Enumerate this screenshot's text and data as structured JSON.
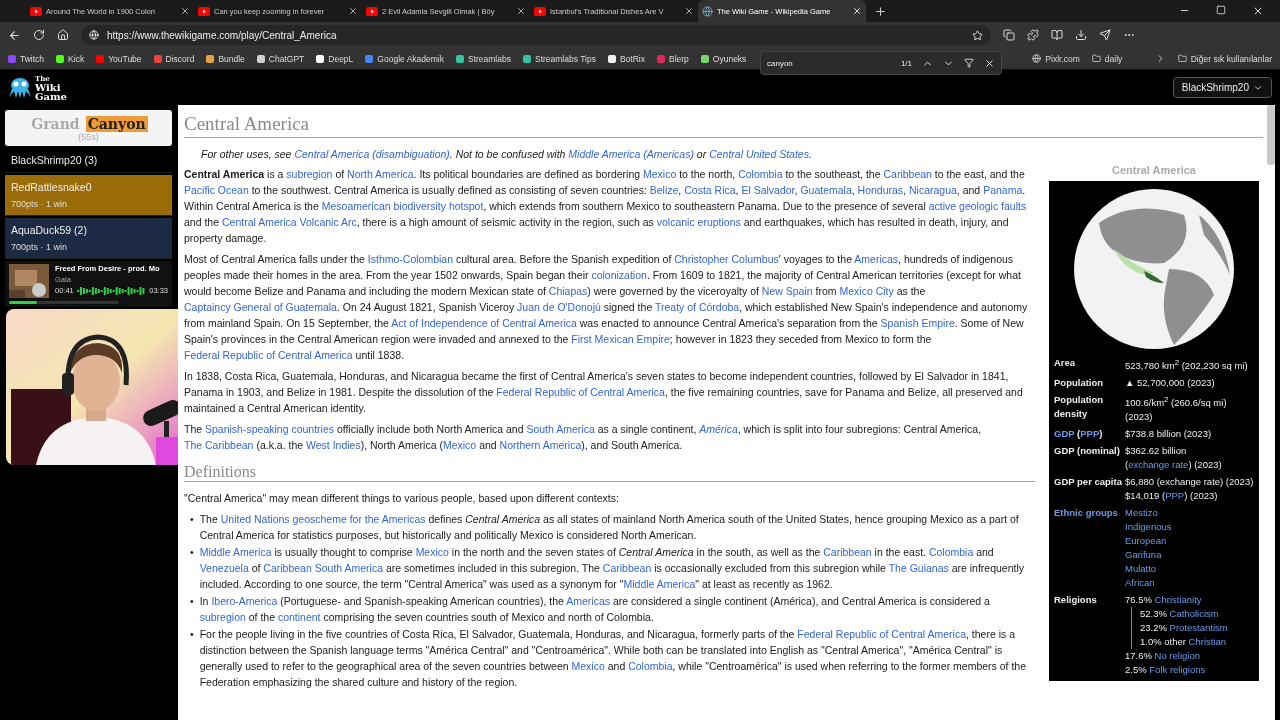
{
  "browser": {
    "tabs": [
      {
        "title": "Around The World in 1900 Colori",
        "kind": "video",
        "selected": false
      },
      {
        "title": "Can you keep zooming in forever",
        "kind": "video",
        "selected": false
      },
      {
        "title": "2 Evli Adamla Sevgili Olmak | Böy",
        "kind": "video",
        "selected": false
      },
      {
        "title": "Istanbul's Traditional Dishes Are V",
        "kind": "video",
        "selected": false
      },
      {
        "title": "The Wiki Game - Wikipedia Game",
        "kind": "page",
        "selected": true
      }
    ],
    "url": "https://www.thewikigame.com/play/Central_America",
    "bookmarks": [
      {
        "label": "Twitch",
        "color": "#9146ff"
      },
      {
        "label": "Kick",
        "color": "#53fc18"
      },
      {
        "label": "YouTube",
        "color": "#ff0000"
      },
      {
        "label": "Discord",
        "color": "#e8453c"
      },
      {
        "label": "Bundle",
        "color": "#e6a23c"
      },
      {
        "label": "ChatGPT",
        "color": "#d0d0d0"
      },
      {
        "label": "DeepL",
        "color": "#ffffff"
      },
      {
        "label": "Google Akademik",
        "color": "#4285f4"
      },
      {
        "label": "Streamlabs",
        "color": "#31c3a2"
      },
      {
        "label": "Streamlabs Tips",
        "color": "#31c3a2"
      },
      {
        "label": "BotRix",
        "color": "#f0f0f0"
      },
      {
        "label": "Blerp",
        "color": "#e0245e"
      },
      {
        "label": "Oyuneks",
        "color": "#7ad66a"
      }
    ],
    "bookmarks_right": [
      {
        "label": "Pixlr.com",
        "kind": "site"
      },
      {
        "label": "daily",
        "kind": "folder"
      }
    ],
    "other_bookmarks": "Diğer sık kullanılanlar",
    "find_bar": {
      "value": "canyon",
      "count": "1/1"
    }
  },
  "header": {
    "logo": [
      "The",
      "Wiki",
      "Game"
    ],
    "user": "BlackShrimp20"
  },
  "target": {
    "parts": [
      {
        "text": "Grand",
        "match": false
      },
      {
        "text": "Canyon",
        "match": true
      }
    ],
    "time": "(55s)"
  },
  "players": [
    {
      "name": "BlackShrimp20 (3)",
      "color": "#000000"
    },
    {
      "name": "RedRattlesnake0",
      "stats": "700pts · 1 win",
      "color": "#9a6d0a"
    },
    {
      "name": "AquaDuck59 (2)",
      "stats": "700pts · 1 win",
      "color": "#1c2a44"
    }
  ],
  "music": {
    "title": "Freed From Desire - prod. Mo",
    "artist": "Gala",
    "elapsed": "00:41",
    "total": "03:33",
    "level": 0.25
  },
  "article": {
    "title": "Central America",
    "hatnote": [
      {
        "text": "For other uses, see "
      },
      {
        "link": "Central America (disambiguation)"
      },
      {
        "text": ". Not to be confused with "
      },
      {
        "link": "Middle America (Americas)"
      },
      {
        "text": " or "
      },
      {
        "link": "Central United States"
      },
      {
        "text": "."
      }
    ],
    "paragraphs": [
      [
        {
          "text": "**Central America** is a "
        },
        {
          "link": "subregion"
        },
        {
          "text": " of "
        },
        {
          "link": "North America"
        },
        {
          "text": ". Its political boundaries are defined as bordering "
        },
        {
          "link": "Mexico"
        },
        {
          "text": " to the north, "
        },
        {
          "link": "Colombia"
        },
        {
          "text": " to the southeast, the "
        },
        {
          "link": "Caribbean"
        },
        {
          "text": " to the east, and the "
        },
        {
          "link": "Pacific Ocean"
        },
        {
          "text": " to the southwest. Central America is usually defined as consisting of seven countries: "
        },
        {
          "link": "Belize"
        },
        {
          "text": ", "
        },
        {
          "link": "Costa Rica"
        },
        {
          "text": ", "
        },
        {
          "link": "El Salvador"
        },
        {
          "text": ", "
        },
        {
          "link": "Guatemala"
        },
        {
          "text": ", "
        },
        {
          "link": "Honduras"
        },
        {
          "text": ", "
        },
        {
          "link": "Nicaragua"
        },
        {
          "text": ", and "
        },
        {
          "link": "Panama"
        },
        {
          "text": ". Within Central America is the "
        },
        {
          "link": "Mesoamerican biodiversity hotspot"
        },
        {
          "text": ", which extends from southern Mexico to southeastern Panama. Due to the presence of several "
        },
        {
          "link": "active geologic faults"
        },
        {
          "text": " and the "
        },
        {
          "link": "Central America Volcanic Arc"
        },
        {
          "text": ", there is a high amount of seismic activity in the region, such as "
        },
        {
          "link": "volcanic eruptions"
        },
        {
          "text": " and earthquakes, which has resulted in death, injury, and property damage."
        }
      ],
      [
        {
          "text": "Most of Central America falls under the "
        },
        {
          "link": "Isthmo-Colombian"
        },
        {
          "text": " cultural area. Before the Spanish expedition of "
        },
        {
          "link": "Christopher Columbus"
        },
        {
          "text": "' voyages to the "
        },
        {
          "link": "Americas"
        },
        {
          "text": ", hundreds of indigenous peoples made their homes in the area. From the year 1502 onwards, Spain began their "
        },
        {
          "link": "colonization"
        },
        {
          "text": ". From 1609 to 1821, the majority of Central American territories (except for what would become Belize and Panama and including the modern Mexican state of "
        },
        {
          "link": "Chiapas"
        },
        {
          "text": ") were governed by the viceroyalty of "
        },
        {
          "link": "New Spain"
        },
        {
          "text": " from "
        },
        {
          "link": "Mexico City"
        },
        {
          "text": " as the "
        },
        {
          "link": "Captaincy General of Guatemala"
        },
        {
          "text": ". On 24 August 1821, Spanish Viceroy "
        },
        {
          "link": "Juan de O'Donojú"
        },
        {
          "text": " signed the "
        },
        {
          "link": "Treaty of Córdoba"
        },
        {
          "text": ", which established New Spain's independence and autonomy from mainland Spain. On 15 September, the "
        },
        {
          "link": "Act of Independence of Central America"
        },
        {
          "text": " was enacted to announce Central America's separation from the "
        },
        {
          "link": "Spanish Empire"
        },
        {
          "text": ". Some of New Spain's provinces in the Central American region were invaded and annexed to the "
        },
        {
          "link": "First Mexican Empire"
        },
        {
          "text": "; however in 1823 they seceded from Mexico to form the "
        },
        {
          "link": "Federal Republic of Central America"
        },
        {
          "text": " until 1838."
        }
      ],
      [
        {
          "text": "In 1838, Costa Rica, Guatemala, Honduras, and Nicaragua became the first of Central America's seven states to become independent countries, followed by El Salvador in 1841, Panama in 1903, and Belize in 1981. Despite the dissolution of the "
        },
        {
          "link": "Federal Republic of Central America"
        },
        {
          "text": ", the five remaining countries, save for Panama and Belize, all preserved and maintained a Central American identity."
        }
      ],
      [
        {
          "text": "The "
        },
        {
          "link": "Spanish-speaking countries"
        },
        {
          "text": " officially include both North America and "
        },
        {
          "link": "South America"
        },
        {
          "text": " as a single continent, "
        },
        {
          "link": "América",
          "italic": true
        },
        {
          "text": ", which is split into four subregions: Central America, "
        },
        {
          "link": "The Caribbean"
        },
        {
          "text": " (a.k.a. the "
        },
        {
          "link": "West Indies"
        },
        {
          "text": "), North America ("
        },
        {
          "link": "Mexico"
        },
        {
          "text": " and "
        },
        {
          "link": "Northern America"
        },
        {
          "text": "), and South America."
        }
      ]
    ],
    "section": {
      "heading": "Definitions",
      "intro": "\"Central America\" may mean different things to various people, based upon different contexts:",
      "bullets": [
        {
          "marker": "•",
          "segs": [
            {
              "text": "The "
            },
            {
              "link": "United Nations geoscheme for the Americas"
            },
            {
              "text": " defines *Central America* as all states of mainland North America south of the United States, hence grouping Mexico as a part of Central America for statistics purposes, but historically and politically Mexico is considered North American."
            }
          ]
        },
        {
          "marker": "•",
          "segs": [
            {
              "link": "Middle America"
            },
            {
              "text": " is usually thought to comprise "
            },
            {
              "link": "Mexico"
            },
            {
              "text": " in the north and the seven states of *Central America* in the south, as well as the "
            },
            {
              "link": "Caribbean"
            },
            {
              "text": " in the east. "
            },
            {
              "link": "Colombia"
            },
            {
              "text": " and "
            },
            {
              "link": "Venezuela"
            },
            {
              "text": " of "
            },
            {
              "link": "Caribbean South America"
            },
            {
              "text": " are sometimes included in this subregion. The "
            },
            {
              "link": "Caribbean"
            },
            {
              "text": " is occasionally excluded from this subregion while "
            },
            {
              "link": "The Guianas"
            },
            {
              "text": " are infrequently included. According to one source, the term \"Central America\" was used as a synonym for \""
            },
            {
              "link": "Middle America"
            },
            {
              "text": "\" at least as recently as 1962."
            }
          ]
        },
        {
          "marker": "•",
          "segs": [
            {
              "text": "In "
            },
            {
              "link": "Ibero-America"
            },
            {
              "text": " (Portuguese- and Spanish-speaking American countries), the "
            },
            {
              "link": "Americas"
            },
            {
              "text": " are considered a single continent (América), and Central America is considered a "
            },
            {
              "link": "subregion"
            },
            {
              "text": " of the "
            },
            {
              "link": "continent"
            },
            {
              "text": " comprising the seven countries south of Mexico and north of Colombia."
            }
          ]
        },
        {
          "marker": "•",
          "segs": [
            {
              "text": "For the people living in the five countries of Costa Rica, El Salvador, Guatemala, Honduras, and Nicaragua, formerly parts of the "
            },
            {
              "link": "Federal Republic of Central America"
            },
            {
              "text": ", there is a distinction between the Spanish language terms \"América Central\" and \"Centroamérica\". While both can be translated into English as \"Central America\", \"América Central\" is generally used to refer to the geographical area of the seven countries between "
            },
            {
              "link": "Mexico"
            },
            {
              "text": " and "
            },
            {
              "link": "Colombia"
            },
            {
              "text": ", while \"Centroamérica\" is used when referring to the former members of the Federation emphasizing the shared culture and history of the region."
            }
          ]
        }
      ]
    }
  },
  "infobox": {
    "caption": "Central America",
    "rows": [
      {
        "label": [
          {
            "text": "Area"
          }
        ],
        "lines": [
          {
            "segs": [
              {
                "text": "523,780 km$^{2}$ (202,230 sq mi)"
              }
            ]
          }
        ]
      },
      {
        "label": [
          {
            "text": "Population"
          }
        ],
        "lines": [
          {
            "segs": [
              {
                "text": "▲ 52,700,000 (2023)"
              }
            ]
          }
        ]
      },
      {
        "label": [
          {
            "text": "Population density"
          }
        ],
        "lines": [
          {
            "segs": [
              {
                "text": "100.6/km$^{2}$ (260.6/sq mi) (2023)"
              }
            ]
          }
        ]
      },
      {
        "label": [
          {
            "link": "GDP"
          },
          {
            "text": " ("
          },
          {
            "link": "PPP"
          },
          {
            "text": ")"
          }
        ],
        "lines": [
          {
            "segs": [
              {
                "text": "$738.8 billion (2023)"
              }
            ]
          }
        ]
      },
      {
        "label": [
          {
            "text": "GDP (nominal)"
          }
        ],
        "lines": [
          {
            "segs": [
              {
                "text": "$362.62 billion ("
              },
              {
                "link": "exchange rate"
              },
              {
                "text": ") (2023)"
              }
            ]
          }
        ]
      },
      {
        "label": [
          {
            "text": "GDP per capita"
          }
        ],
        "lines": [
          {
            "segs": [
              {
                "text": "$6,880 (exchange rate) (2023)"
              }
            ]
          },
          {
            "segs": [
              {
                "text": "$14,019 ("
              },
              {
                "link": "PPP"
              },
              {
                "text": ") (2023)"
              }
            ]
          }
        ]
      },
      {
        "label": [
          {
            "link": "Ethnic groups"
          }
        ],
        "lines": [
          {
            "segs": [
              {
                "link": "Mestizo"
              }
            ]
          },
          {
            "segs": [
              {
                "link": "Indigenous"
              }
            ]
          },
          {
            "segs": [
              {
                "link": "European"
              }
            ]
          },
          {
            "segs": [
              {
                "link": "Garifuna"
              }
            ]
          },
          {
            "segs": [
              {
                "link": "Mulatto"
              }
            ]
          },
          {
            "segs": [
              {
                "link": "African"
              }
            ]
          }
        ]
      },
      {
        "label": [
          {
            "text": "Religions"
          }
        ],
        "lines": [
          {
            "segs": [
              {
                "text": "76.5% "
              },
              {
                "link": "Christianity"
              }
            ],
            "children": [
              {
                "segs": [
                  {
                    "text": "52.3% "
                  },
                  {
                    "link": "Catholicism"
                  }
                ]
              },
              {
                "segs": [
                  {
                    "text": "23.2% "
                  },
                  {
                    "link": "Protestantism"
                  }
                ]
              },
              {
                "segs": [
                  {
                    "text": "1.0% other "
                  },
                  {
                    "link": "Christian"
                  }
                ]
              }
            ]
          },
          {
            "segs": [
              {
                "text": "17.6% "
              },
              {
                "link": "No religion"
              }
            ]
          },
          {
            "segs": [
              {
                "text": "2.5% "
              },
              {
                "link": "Folk religions"
              }
            ]
          }
        ]
      }
    ]
  }
}
